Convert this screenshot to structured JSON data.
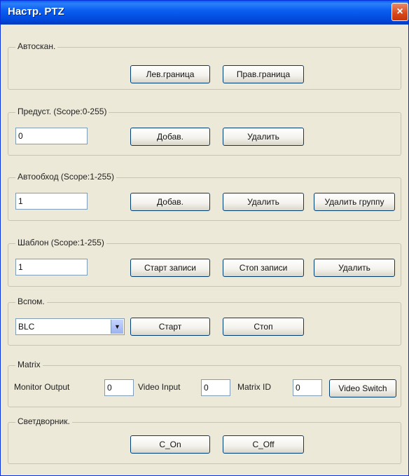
{
  "window": {
    "title": "Настр. PTZ",
    "close_icon": "×"
  },
  "autoscan": {
    "label": "Автоскан.",
    "left_boundary": "Лев.граница",
    "right_boundary": "Прав.граница"
  },
  "preset": {
    "label": "Предуст. (Scope:0-255)",
    "value": "0",
    "add": "Добав.",
    "delete": "Удалить"
  },
  "tour": {
    "label": "Автообход (Scope:1-255)",
    "value": "1",
    "add": "Добав.",
    "delete": "Удалить",
    "delete_group": "Удалить группу"
  },
  "pattern": {
    "label": "Шаблон (Scope:1-255)",
    "value": "1",
    "start_record": "Старт записи",
    "stop_record": "Стоп записи",
    "delete": "Удалить"
  },
  "aux": {
    "label": "Вспом.",
    "selected": "BLC",
    "dropdown_icon": "▼",
    "start": "Старт",
    "stop": "Стоп"
  },
  "matrix": {
    "label": "Matrix",
    "monitor_output_label": "Monitor Output",
    "monitor_output_value": "0",
    "video_input_label": "Video Input",
    "video_input_value": "0",
    "matrix_id_label": "Matrix ID",
    "matrix_id_value": "0",
    "video_switch": "Video Switch"
  },
  "light": {
    "label": "Светдворник.",
    "on": "C_On",
    "off": "C_Off"
  }
}
